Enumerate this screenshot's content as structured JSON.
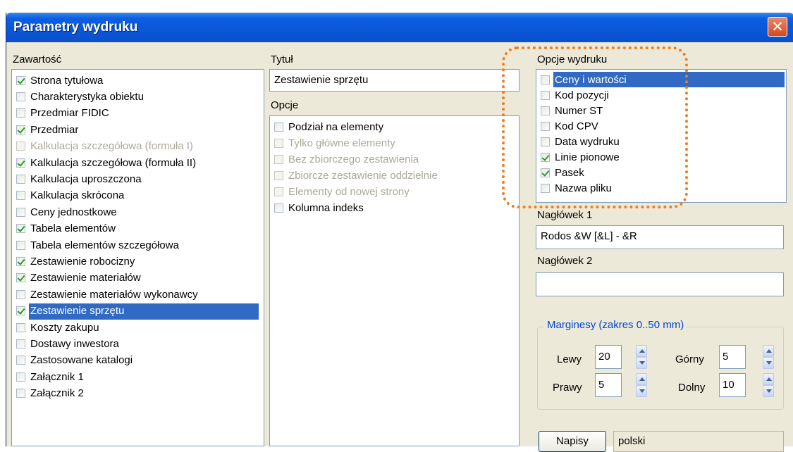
{
  "dialog": {
    "title": "Parametry wydruku",
    "close_glyph": "✕",
    "close_icon": "close-icon"
  },
  "content": {
    "label": "Zawartość",
    "items": [
      {
        "label": "Strona tytułowa",
        "checked": true,
        "disabled": false,
        "selected": false
      },
      {
        "label": "Charakterystyka obiektu",
        "checked": false,
        "disabled": false,
        "selected": false
      },
      {
        "label": "Przedmiar FIDIC",
        "checked": false,
        "disabled": false,
        "selected": false
      },
      {
        "label": "Przedmiar",
        "checked": true,
        "disabled": false,
        "selected": false
      },
      {
        "label": "Kalkulacja szczegółowa (formuła I)",
        "checked": false,
        "disabled": true,
        "selected": false
      },
      {
        "label": "Kalkulacja szczegółowa (formuła II)",
        "checked": true,
        "disabled": false,
        "selected": false
      },
      {
        "label": "Kalkulacja uproszczona",
        "checked": false,
        "disabled": false,
        "selected": false
      },
      {
        "label": "Kalkulacja skrócona",
        "checked": false,
        "disabled": false,
        "selected": false
      },
      {
        "label": "Ceny jednostkowe",
        "checked": false,
        "disabled": false,
        "selected": false
      },
      {
        "label": "Tabela elementów",
        "checked": true,
        "disabled": false,
        "selected": false
      },
      {
        "label": "Tabela elementów szczegółowa",
        "checked": false,
        "disabled": false,
        "selected": false
      },
      {
        "label": "Zestawienie robocizny",
        "checked": true,
        "disabled": false,
        "selected": false
      },
      {
        "label": "Zestawienie materiałów",
        "checked": true,
        "disabled": false,
        "selected": false
      },
      {
        "label": "Zestawienie materiałów wykonawcy",
        "checked": false,
        "disabled": false,
        "selected": false
      },
      {
        "label": "Zestawienie sprzętu",
        "checked": true,
        "disabled": false,
        "selected": true
      },
      {
        "label": "Koszty zakupu",
        "checked": false,
        "disabled": false,
        "selected": false
      },
      {
        "label": "Dostawy inwestora",
        "checked": false,
        "disabled": false,
        "selected": false
      },
      {
        "label": "Zastosowane katalogi",
        "checked": false,
        "disabled": false,
        "selected": false
      },
      {
        "label": "Załącznik 1",
        "checked": false,
        "disabled": false,
        "selected": false
      },
      {
        "label": "Załącznik 2",
        "checked": false,
        "disabled": false,
        "selected": false
      }
    ]
  },
  "title_field": {
    "label": "Tytuł",
    "value": "Zestawienie sprzętu"
  },
  "options": {
    "label": "Opcje",
    "items": [
      {
        "label": "Podział na elementy",
        "checked": false,
        "disabled": false
      },
      {
        "label": "Tylko główne elementy",
        "checked": false,
        "disabled": true
      },
      {
        "label": "Bez zbiorczego zestawienia",
        "checked": false,
        "disabled": true
      },
      {
        "label": "Zbiorcze zestawienie oddzielnie",
        "checked": false,
        "disabled": true
      },
      {
        "label": "Elementy od nowej strony",
        "checked": false,
        "disabled": true
      },
      {
        "label": "Kolumna indeks",
        "checked": false,
        "disabled": false
      }
    ]
  },
  "print_options": {
    "label": "Opcje wydruku",
    "items": [
      {
        "label": "Ceny i wartości",
        "checked": false,
        "selected": true
      },
      {
        "label": "Kod pozycji",
        "checked": false,
        "selected": false
      },
      {
        "label": "Numer ST",
        "checked": false,
        "selected": false
      },
      {
        "label": "Kod CPV",
        "checked": false,
        "selected": false
      },
      {
        "label": "Data wydruku",
        "checked": false,
        "selected": false
      },
      {
        "label": "Linie pionowe",
        "checked": true,
        "selected": false
      },
      {
        "label": "Pasek",
        "checked": true,
        "selected": false
      },
      {
        "label": "Nazwa pliku",
        "checked": false,
        "selected": false
      }
    ]
  },
  "header1": {
    "label": "Nagłówek 1",
    "value": "Rodos &W [&L] - &R"
  },
  "header2": {
    "label": "Nagłówek 2",
    "value": ""
  },
  "margins": {
    "title": "Marginesy (zakres 0..50 mm)",
    "left_label": "Lewy",
    "left_value": "20",
    "top_label": "Górny",
    "top_value": "5",
    "right_label": "Prawy",
    "right_value": "5",
    "bottom_label": "Dolny",
    "bottom_value": "10"
  },
  "footer": {
    "napisy_label": "Napisy",
    "language_value": "polski"
  },
  "accent_colors": {
    "titlebar": "#0b5ee0",
    "selection": "#316ac5",
    "highlight": "#f07c1a"
  }
}
